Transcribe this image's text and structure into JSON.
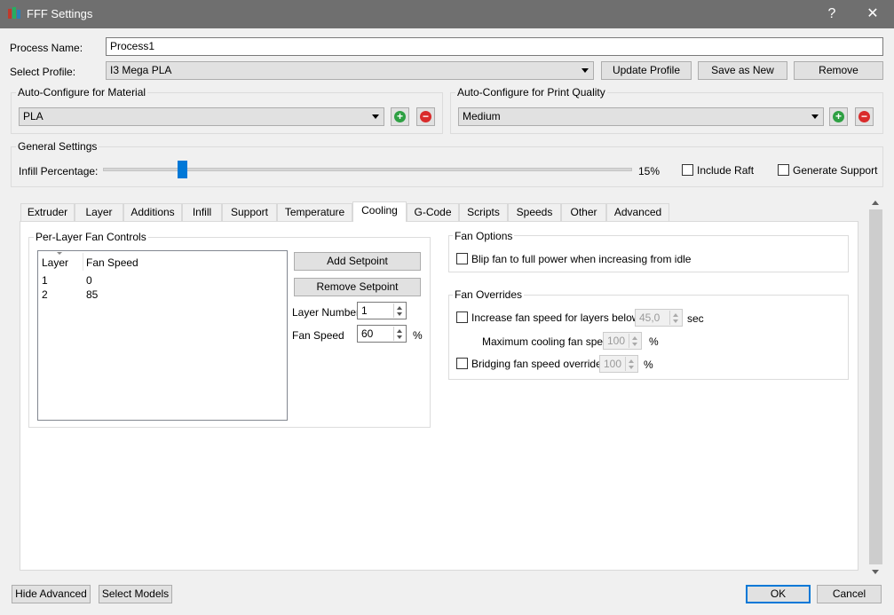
{
  "window": {
    "title": "FFF Settings",
    "help": "?",
    "close": "✕"
  },
  "process": {
    "label": "Process Name:",
    "value": "Process1"
  },
  "profile": {
    "label": "Select Profile:",
    "value": "I3 Mega PLA",
    "update": "Update Profile",
    "save_new": "Save as New",
    "remove": "Remove"
  },
  "material": {
    "label": "Auto-Configure for Material",
    "value": "PLA"
  },
  "quality": {
    "label": "Auto-Configure for Print Quality",
    "value": "Medium"
  },
  "general": {
    "label": "General Settings",
    "infill_label": "Infill Percentage:",
    "infill_fraction": 0.15,
    "infill_value": "15%",
    "raft": "Include Raft",
    "support": "Generate Support"
  },
  "tabs": [
    "Extruder",
    "Layer",
    "Additions",
    "Infill",
    "Support",
    "Temperature",
    "Cooling",
    "G-Code",
    "Scripts",
    "Speeds",
    "Other",
    "Advanced"
  ],
  "active_tab": "Cooling",
  "fan_controls": {
    "label": "Per-Layer Fan Controls",
    "col_layer": "Layer",
    "col_speed": "Fan Speed",
    "rows": [
      {
        "layer": "1",
        "speed": "0"
      },
      {
        "layer": "2",
        "speed": "85"
      }
    ],
    "add": "Add Setpoint",
    "remove": "Remove Setpoint",
    "layer_number_label": "Layer Number",
    "layer_number": "1",
    "fan_speed_label": "Fan Speed",
    "fan_speed": "60",
    "percent": "%"
  },
  "fan_options": {
    "label": "Fan Options",
    "blip": "Blip fan to full power when increasing from idle"
  },
  "fan_overrides": {
    "label": "Fan Overrides",
    "increase": "Increase fan speed for layers below",
    "increase_value": "45,0",
    "sec": "sec",
    "max_label": "Maximum cooling fan speed",
    "max_value": "100",
    "max_unit": "%",
    "bridging": "Bridging fan speed override",
    "bridging_value": "100",
    "bridging_unit": "%"
  },
  "footer": {
    "hide_advanced": "Hide Advanced",
    "select_models": "Select Models",
    "ok": "OK",
    "cancel": "Cancel"
  },
  "colors": {
    "accent": "#0078d7",
    "add": "#2ea043",
    "remove": "#d92b2b",
    "titlebar": "#6f6f6f"
  }
}
